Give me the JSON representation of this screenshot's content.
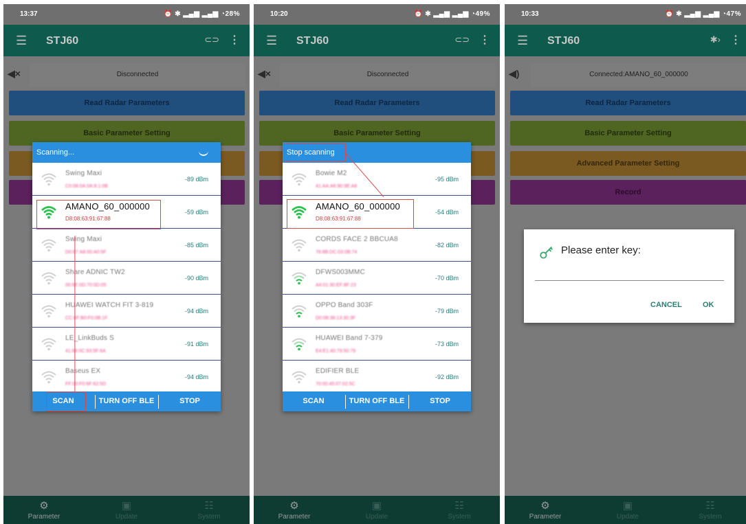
{
  "colors": {
    "accent": "#2b8fe0",
    "wifi_strong": "#27c24c",
    "wifi_weak": "#c8c8c8",
    "rssi": "#2a7d7a",
    "mac": "#e94989",
    "annotation": "#d84a4a",
    "dialog_button": "#2b7e74"
  },
  "app": {
    "title": "STJ60",
    "nav": {
      "parameter": "Parameter",
      "update": "Update",
      "system": "System"
    }
  },
  "main_buttons": {
    "read": "Read Radar Parameters",
    "basic": "Basic Parameter Setting",
    "advanced": "Advanced Parameter Setting",
    "record": "Record"
  },
  "scan_footer": {
    "scan": "SCAN",
    "turn_off": "TURN OFF BLE",
    "stop": "STOP"
  },
  "screens": [
    {
      "time": "13:37",
      "status_icons": "⏰ ✱ ▂▄▆ ▂▄▆ ◔28%",
      "connection": "Disconnected",
      "dialog_title": "Scanning...",
      "devices": [
        {
          "name": "Swing Maxi",
          "mac": "C0:08:0A:0A:8:1:0B",
          "rssi": "-89 dBm",
          "signal": "weak"
        },
        {
          "name": "AMANO_60_000000",
          "mac": "D8:08:63:91:67:88",
          "rssi": "-59 dBm",
          "signal": "strong"
        },
        {
          "name": "Swing Maxi",
          "mac": "D0:87:A8:00:A0:5F",
          "rssi": "-85 dBm",
          "signal": "weak"
        },
        {
          "name": "Share ADNIC TW2",
          "mac": "00:6E:0D:70:0D:05",
          "rssi": "-90 dBm",
          "signal": "weak"
        },
        {
          "name": "HUAWEI WATCH FIT 3-819",
          "mac": "CC:8F:B0:F0:0B:1F",
          "rssi": "-94 dBm",
          "signal": "weak"
        },
        {
          "name": "LE_LinkBuds S",
          "mac": "41:88:0C:93:5F:6A",
          "rssi": "-91 dBm",
          "signal": "weak"
        },
        {
          "name": "Baseus EX",
          "mac": "FF:00:F0:6F:62:5D",
          "rssi": "-94 dBm",
          "signal": "weak"
        }
      ]
    },
    {
      "time": "10:20",
      "status_icons": "⏰ ✱ ▂▄▆ ▂▄▆ ◔49%",
      "connection": "Disconnected",
      "dialog_title": "Stop scanning",
      "devices": [
        {
          "name": "Bowie M2",
          "mac": "41:AA:A6:90:9E:A8",
          "rssi": "-95 dBm",
          "signal": "weak"
        },
        {
          "name": "AMANO_60_000000",
          "mac": "D8:08:63:91:67:88",
          "rssi": "-54 dBm",
          "signal": "strong"
        },
        {
          "name": "CORDS FACE 2 BBCUA8",
          "mac": "76:8B:DC:03:0B:74",
          "rssi": "-82 dBm",
          "signal": "weak"
        },
        {
          "name": "DFWS003MMC",
          "mac": "A4:01:30:EF:8F:23",
          "rssi": "-70 dBm",
          "signal": "medium"
        },
        {
          "name": "OPPO Band 303F",
          "mac": "D0:08:38:13:30:3F",
          "rssi": "-79 dBm",
          "signal": "medium"
        },
        {
          "name": "HUAWEI Band 7-379",
          "mac": "E4:E1:40:79:50:79",
          "rssi": "-73 dBm",
          "signal": "medium"
        },
        {
          "name": "EDIFIER BLE",
          "mac": "70:00:45:07:02:5C",
          "rssi": "-92 dBm",
          "signal": "weak"
        }
      ]
    },
    {
      "time": "10:33",
      "status_icons": "⏰ ✱ ▂▄▆ ▂▄▆ ◔47%",
      "connection": "Connected:AMANO_60_000000",
      "key_dialog": {
        "title": "Please enter key:",
        "cancel": "CANCEL",
        "ok": "OK"
      }
    }
  ]
}
